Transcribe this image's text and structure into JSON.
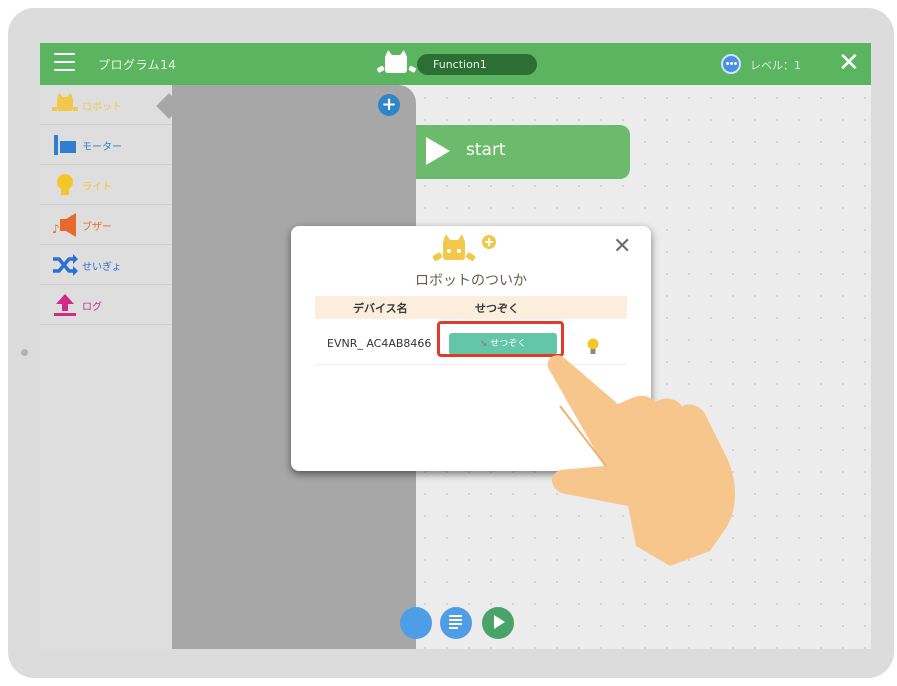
{
  "topbar": {
    "program_title": "プログラム14",
    "function_name": "Function1",
    "level_label": "レベル：1",
    "close_symbol": "✕"
  },
  "sidebar": {
    "items": [
      {
        "label": "ロボット",
        "icon": "robot-icon",
        "color": "#f2c84b"
      },
      {
        "label": "モーター",
        "icon": "motor-icon",
        "color": "#2f7fd1"
      },
      {
        "label": "ライト",
        "icon": "lightbulb-icon",
        "color": "#f4c62a"
      },
      {
        "label": "ブザー",
        "icon": "buzzer-icon",
        "color": "#e86a2a"
      },
      {
        "label": "せいぎょ",
        "icon": "shuffle-icon",
        "color": "#2d6fd0"
      },
      {
        "label": "ログ",
        "icon": "upload-icon",
        "color": "#cf2a86"
      }
    ]
  },
  "workspace": {
    "start_block_label": "start",
    "bottom_buttons": [
      {
        "icon": "list-icon",
        "label": "source"
      },
      {
        "icon": "play-icon",
        "label": "start"
      }
    ]
  },
  "modal": {
    "title": "ロボットのついか",
    "close_symbol": "✕",
    "columns": [
      "デバイス名",
      "せつぞく"
    ],
    "rows": [
      {
        "device_name": "EVNR_ AC4AB8466",
        "connect_label": "せつぞく"
      }
    ]
  },
  "colors": {
    "topbar": "#5bb460",
    "panel": "#a7a7a7",
    "connect_button": "#63c6a6",
    "highlight": "#e03b2f"
  }
}
